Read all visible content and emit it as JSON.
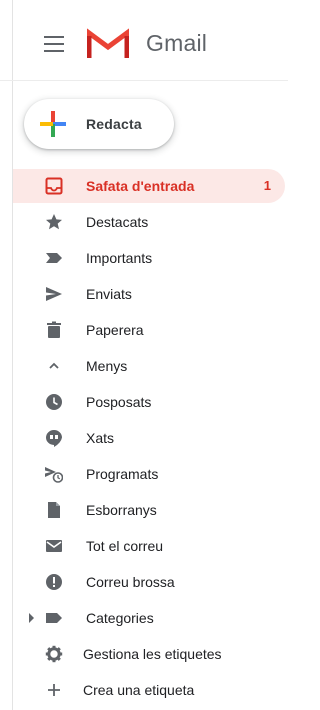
{
  "header": {
    "app_name": "Gmail"
  },
  "compose": {
    "label": "Redacta"
  },
  "nav": {
    "items": [
      {
        "label": "Safata d'entrada",
        "icon": "inbox-icon",
        "count": "1",
        "active": true
      },
      {
        "label": "Destacats",
        "icon": "star-icon"
      },
      {
        "label": "Importants",
        "icon": "important-icon"
      },
      {
        "label": "Enviats",
        "icon": "send-icon"
      },
      {
        "label": "Paperera",
        "icon": "trash-icon"
      },
      {
        "label": "Menys",
        "icon": "chevron-up-icon"
      },
      {
        "label": "Posposats",
        "icon": "clock-icon"
      },
      {
        "label": "Xats",
        "icon": "chat-icon"
      },
      {
        "label": "Programats",
        "icon": "scheduled-send-icon"
      },
      {
        "label": "Esborranys",
        "icon": "draft-icon"
      },
      {
        "label": "Tot el correu",
        "icon": "all-mail-icon"
      },
      {
        "label": "Correu brossa",
        "icon": "spam-icon"
      },
      {
        "label": "Categories",
        "icon": "label-icon"
      },
      {
        "label": "Gestiona les etiquetes",
        "icon": "gear-icon"
      },
      {
        "label": "Crea una etiqueta",
        "icon": "plus-icon"
      }
    ]
  },
  "colors": {
    "accent_red": "#d93025",
    "active_bg": "#fce8e6",
    "icon_gray": "#5f6368"
  }
}
